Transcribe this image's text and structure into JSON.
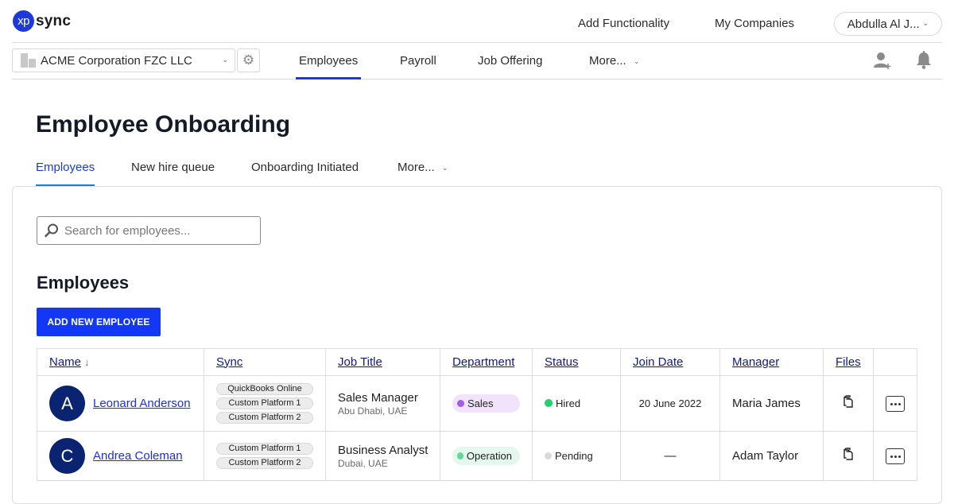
{
  "app": {
    "logo_mark": "xp",
    "logo_text": "sync",
    "brand_color": "#1d3ad8"
  },
  "topbar": {
    "links": [
      "Add Functionality",
      "My Companies"
    ],
    "user_menu": "Abdulla Al J..."
  },
  "navbar": {
    "company": "ACME Corporation FZC LLC",
    "tabs": [
      {
        "label": "Employees",
        "active": true
      },
      {
        "label": "Payroll",
        "active": false
      },
      {
        "label": "Job Offering",
        "active": false
      },
      {
        "label": "More...",
        "active": false
      }
    ],
    "icons": [
      "add-user-icon",
      "bell-icon",
      "gear-icon",
      "building-icon"
    ]
  },
  "page": {
    "title": "Employee Onboarding",
    "tabs": [
      {
        "label": "Employees",
        "active": true
      },
      {
        "label": "New hire queue",
        "active": false
      },
      {
        "label": "Onboarding Initiated",
        "active": false
      },
      {
        "label": "More...",
        "active": false
      }
    ]
  },
  "employees_section": {
    "search_placeholder": "Search for employees...",
    "search_value": "",
    "title": "Employees",
    "add_button": "ADD NEW EMPLOYEE",
    "columns": [
      "Name",
      "Sync",
      "Job Title",
      "Department",
      "Status",
      "Join Date",
      "Manager",
      "Files",
      ""
    ],
    "sort": {
      "column": "Name",
      "direction": "descending",
      "icon": "arrow-down-icon"
    },
    "rows": [
      {
        "initial": "A",
        "name": "Leonard Anderson",
        "sync": [
          "QuickBooks Online",
          "Custom Platform 1",
          "Custom Platform 2"
        ],
        "job_title": "Sales Manager",
        "location": "Abu Dhabi, UAE",
        "department": "Sales",
        "department_color": "#a35de6",
        "department_bg": "#f0e3fb",
        "status": "Hired",
        "status_color": "#1fd26a",
        "join_date": "20 June 2022",
        "manager": "Maria James"
      },
      {
        "initial": "C",
        "name": "Andrea Coleman",
        "sync": [
          "Custom Platform 1",
          "Custom Platform 2"
        ],
        "job_title": "Business Analyst",
        "location": "Dubai, UAE",
        "department": "Operation",
        "department_color": "#5ddb94",
        "department_bg": "#e5f8ee",
        "status": "Pending",
        "status_color": "#d9d9d9",
        "join_date": "—",
        "manager": "Adam Taylor"
      }
    ]
  }
}
